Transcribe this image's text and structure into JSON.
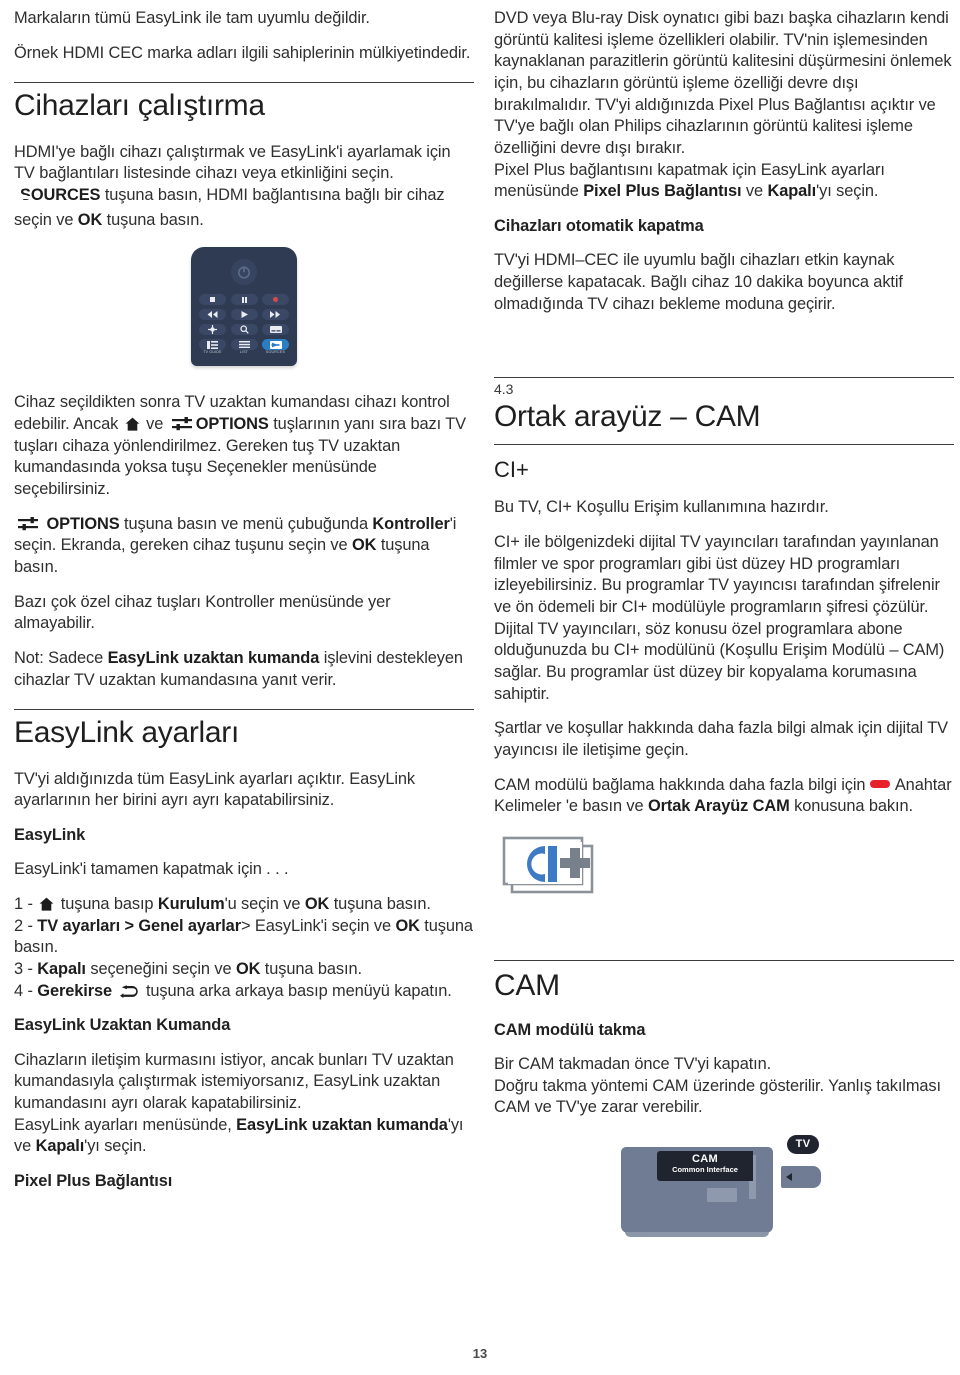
{
  "page_number": "13",
  "left_column": {
    "intro_paragraphs": [
      "Markaların tümü EasyLink ile tam uyumlu değildir.",
      "Örnek HDMI CEC marka adları ilgili sahiplerinin mülkiyetindedir."
    ],
    "section_operate": {
      "heading": "Cihazları çalıştırma",
      "para_pre": "HDMI'ye bağlı cihazı çalıştırmak ve EasyLink'i ayarlamak için TV bağlantıları listesinde cihazı veya etkinliğini seçin. ",
      "sources_icon": "sources-icon",
      "sources_label": "SOURCES",
      "para_mid": " tuşuna basın, HDMI bağlantısına bağlı bir cihaz seçin ve ",
      "ok_label": "OK",
      "para_end": " tuşuna basın."
    },
    "remote": {
      "power_icon": "power-icon",
      "keys": [
        {
          "name": "stop-key",
          "glyph": "stop"
        },
        {
          "name": "pause-key",
          "glyph": "pause"
        },
        {
          "name": "record-key",
          "glyph": "record"
        },
        {
          "name": "rewind-key",
          "glyph": "rewind"
        },
        {
          "name": "play-key",
          "glyph": "play"
        },
        {
          "name": "fast-forward-key",
          "glyph": "fast-forward"
        },
        {
          "name": "settings-key",
          "glyph": "gear"
        },
        {
          "name": "search-key",
          "glyph": "search"
        },
        {
          "name": "subtitle-key",
          "glyph": "subtitle"
        }
      ],
      "bottom_keys": [
        {
          "name": "tv-guide-key",
          "label": "TV GUIDE"
        },
        {
          "name": "list-key",
          "label": "LIST"
        },
        {
          "name": "sources-key",
          "label": "SOURCES",
          "highlight": true
        }
      ],
      "highlight_color": "#2a7fc4",
      "body_color": "#2e3b52"
    },
    "after_remote": {
      "p1_a": "Cihaz seçildikten sonra TV uzaktan kumandası cihazı kontrol edebilir. Ancak ",
      "home_icon": "home-icon",
      "p1_b": " ve ",
      "options_icon": "options-icon",
      "options_label": "OPTIONS",
      "p1_c": " tuşlarının yanı sıra bazı TV tuşları cihaza yönlendirilmez. Gereken tuş TV uzaktan kumandasında yoksa tuşu Seçenekler menüsünde seçebilirsiniz.",
      "p2_a": " tuşuna basın ve menü çubuğunda ",
      "p2_b": "Kontroller",
      "p2_c": "'i seçin. Ekranda, gereken cihaz tuşunu seçin ve ",
      "p2_ok": "OK",
      "p2_d": " tuşuna basın.",
      "p3": "Bazı çok özel cihaz tuşları Kontroller menüsünde yer almayabilir.",
      "p4_a": "Not: Sadece ",
      "p4_b": "EasyLink uzaktan kumanda",
      "p4_c": " işlevini destekleyen cihazlar TV uzaktan kumandasına yanıt verir."
    },
    "section_settings": {
      "heading": "EasyLink ayarları",
      "p1": "TV'yi aldığınızda tüm EasyLink ayarları açıktır. EasyLink ayarlarının her birini ayrı ayrı kapatabilirsiniz.",
      "sub1": "EasyLink",
      "p2": "EasyLink'i tamamen kapatmak için . . .",
      "step1_num": "1 - ",
      "step1_a": " tuşuna basıp ",
      "step1_b": "Kurulum",
      "step1_c": "'u seçin ve ",
      "step1_ok": "OK",
      "step1_d": " tuşuna basın.",
      "step2_num": "2 - ",
      "step2_b": "TV ayarları > Genel ayarlar",
      "step2_c": "> EasyLink'i seçin ve ",
      "step2_ok": "OK",
      "step2_d": " tuşuna basın.",
      "step3_num": "3 - ",
      "step3_b": "Kapalı",
      "step3_c": " seçeneğini seçin ve ",
      "step3_ok": "OK",
      "step3_d": " tuşuna basın.",
      "step4_num": "4 - ",
      "step4_a": "Gerekirse ",
      "back_icon": "back-icon",
      "step4_b": " tuşuna arka arkaya basıp menüyü kapatın.",
      "sub2": "EasyLink Uzaktan Kumanda",
      "p3": "Cihazların iletişim kurmasını istiyor, ancak bunları TV uzaktan kumandasıyla çalıştırmak istemiyorsanız, EasyLink uzaktan kumandasını ayrı olarak kapatabilirsiniz.",
      "p4_a": "EasyLink ayarları menüsünde, ",
      "p4_b": "EasyLink uzaktan kumanda",
      "p4_c": "'yı ve ",
      "p4_d": "Kapalı",
      "p4_e": "'yı seçin.",
      "sub3": "Pixel Plus Bağlantısı"
    }
  },
  "right_column": {
    "pixel_plus": {
      "p1_a": "DVD veya Blu-ray Disk oynatıcı gibi bazı başka cihazların kendi görüntü kalitesi işleme özellikleri olabilir. TV'nin işlemesinden kaynaklanan parazitlerin görüntü kalitesini düşürmesini önlemek için, bu cihazların görüntü işleme özelliği devre dışı bırakılmalıdır. TV'yi aldığınızda Pixel Plus Bağlantısı açıktır ve TV'ye bağlı olan Philips cihazlarının görüntü kalitesi işleme özelliğini devre dışı bırakır.",
      "p2_a": "Pixel Plus bağlantısını kapatmak için EasyLink ayarları menüsünde ",
      "p2_b": "Pixel Plus Bağlantısı",
      "p2_c": " ve ",
      "p2_d": "Kapalı",
      "p2_e": "'yı seçin."
    },
    "auto_off": {
      "sub": "Cihazları otomatik kapatma",
      "p1": "TV'yi HDMI–CEC ile uyumlu bağlı cihazları etkin kaynak değillerse kapatacak. Bağlı cihaz 10 dakika boyunca aktif olmadığında TV cihazı bekleme moduna geçirir."
    },
    "section_cam": {
      "number": "4.3",
      "heading": "Ortak arayüz – CAM",
      "ci_heading": "CI+",
      "p1": "Bu TV, CI+ Koşullu Erişim kullanımına hazırdır.",
      "p2": "CI+ ile bölgenizdeki dijital TV yayıncıları tarafından yayınlanan filmler ve spor programları gibi üst düzey HD programları izleyebilirsiniz. Bu programlar TV yayıncısı tarafından şifrelenir ve ön ödemeli bir CI+ modülüyle programların şifresi çözülür. Dijital TV yayıncıları, söz konusu özel programlara abone olduğunuzda bu CI+ modülünü (Koşullu Erişim Modülü – CAM) sağlar. Bu programlar üst düzey bir kopyalama korumasına sahiptir.",
      "p3": "Şartlar ve koşullar hakkında daha fazla bilgi almak için dijital TV yayıncısı ile iletişime geçin.",
      "p4_a": "CAM modülü bağlama hakkında daha fazla bilgi için ",
      "key_icon": "red-key-icon",
      "p4_b": "Anahtar Kelimeler",
      "p4_c": " 'e basın ve ",
      "p4_d": "Ortak Arayüz CAM",
      "p4_e": " konusuna bakın.",
      "ciplus_logo_text": "CI+",
      "ciplus_logo_colors": {
        "letters": "#3e7bc6",
        "plus": "#78808c",
        "frame": "#8c9299"
      }
    },
    "section_cam2": {
      "heading": "CAM",
      "sub": "CAM modülü takma",
      "p1": "Bir CAM takmadan önce TV'yi kapatın.",
      "p2": "Doğru takma yöntemi CAM üzerinde gösterilir. Yanlış takılması CAM ve TV'ye zarar verebilir.",
      "figure": {
        "cam_title": "CAM",
        "cam_subtitle": "Common Interface",
        "tv_badge": "TV",
        "card_color": "#6f7c94",
        "label_color": "#20242f"
      }
    }
  }
}
